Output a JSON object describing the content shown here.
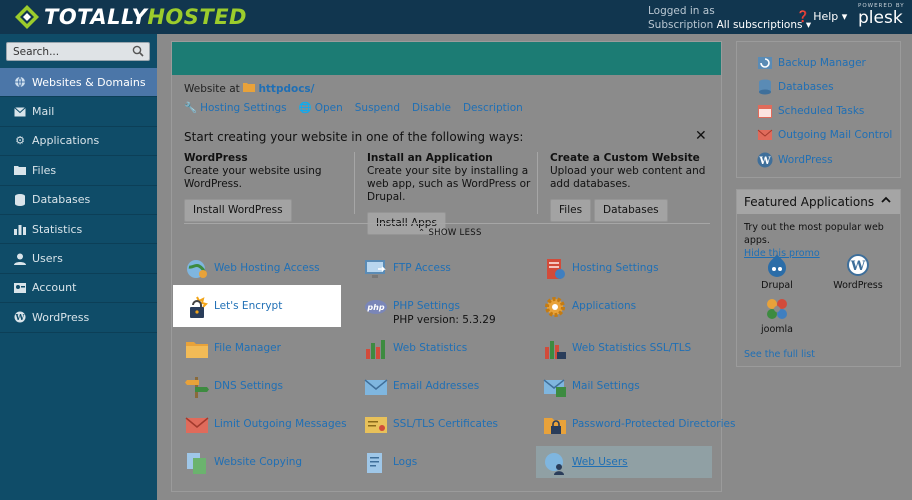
{
  "header": {
    "logo_text_1": "TOTALLY",
    "logo_text_2": "HOSTED",
    "logged_in_label": "Logged in as",
    "subscription_label": "Subscription",
    "subscription_value": "All subscriptions",
    "help_label": "Help",
    "plesk_powered": "POWERED BY",
    "plesk_label": "plesk"
  },
  "sidebar": {
    "search_placeholder": "Search...",
    "items": [
      {
        "label": "Websites & Domains"
      },
      {
        "label": "Mail"
      },
      {
        "label": "Applications"
      },
      {
        "label": "Files"
      },
      {
        "label": "Databases"
      },
      {
        "label": "Statistics"
      },
      {
        "label": "Users"
      },
      {
        "label": "Account"
      },
      {
        "label": "WordPress"
      }
    ]
  },
  "main": {
    "website_at": "Website at",
    "domain": "httpdocs/",
    "actions": [
      "Hosting Settings",
      "Open",
      "Suspend",
      "Disable",
      "Description"
    ],
    "start_title": "Start creating your website in one of the following ways:",
    "columns": [
      {
        "title": "WordPress",
        "desc": "Create your website using WordPress.",
        "buttons": [
          "Install WordPress"
        ]
      },
      {
        "title": "Install an Application",
        "desc": "Create your site by installing a web app, such as WordPress or Drupal.",
        "buttons": [
          "Install Apps"
        ]
      },
      {
        "title": "Create a Custom Website",
        "desc": "Upload your web content and add databases.",
        "buttons": [
          "Files",
          "Databases"
        ]
      }
    ],
    "show_less": "SHOW LESS",
    "tools": [
      {
        "label": "Web Hosting Access"
      },
      {
        "label": "FTP Access"
      },
      {
        "label": "Hosting Settings"
      },
      {
        "label": "Let's Encrypt"
      },
      {
        "label": "PHP Settings",
        "sub": "PHP version: 5.3.29"
      },
      {
        "label": "Applications"
      },
      {
        "label": "File Manager"
      },
      {
        "label": "Web Statistics"
      },
      {
        "label": "Web Statistics SSL/TLS"
      },
      {
        "label": "DNS Settings"
      },
      {
        "label": "Email Addresses"
      },
      {
        "label": "Mail Settings"
      },
      {
        "label": "Limit Outgoing Messages"
      },
      {
        "label": "SSL/TLS Certificates"
      },
      {
        "label": "Password-Protected Directories"
      },
      {
        "label": "Website Copying"
      },
      {
        "label": "Logs"
      },
      {
        "label": "Web Users"
      }
    ]
  },
  "right": {
    "links": [
      "Backup Manager",
      "Databases",
      "Scheduled Tasks",
      "Outgoing Mail Control",
      "WordPress"
    ],
    "featured": {
      "title": "Featured Applications",
      "desc": "Try out the most popular web apps.",
      "hide": "Hide this promo",
      "apps": [
        "Drupal",
        "WordPress",
        "joomla"
      ],
      "full_list": "See the full list"
    }
  },
  "colors": {
    "header_bg": "#11364f",
    "sidebar_bg": "#0f4c68",
    "sidebar_active": "#4b76a8",
    "topbar": "#1c7c74",
    "link": "#1f6fb5",
    "brand_green": "#9ccc2c"
  }
}
